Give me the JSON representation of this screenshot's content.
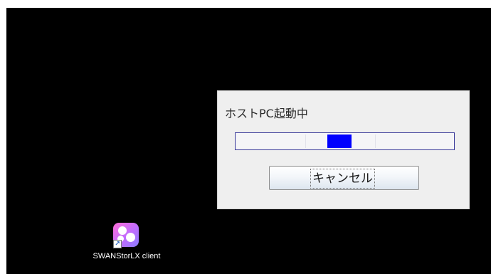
{
  "dialog": {
    "title": "ホストPC起動中",
    "progress": {
      "indeterminate": true,
      "indicator_start_fraction": 0.42,
      "indicator_end_fraction": 0.53,
      "fill_color": "#0000ff",
      "border_color": "#3a3a9a"
    },
    "cancel_label": "キャンセル"
  },
  "desktop": {
    "background_color": "#000000",
    "icons": [
      {
        "label": "SWANStorLX client",
        "icon": "swanstorlx-app-icon",
        "shortcut_overlay": "shortcut-arrow-icon"
      }
    ]
  }
}
